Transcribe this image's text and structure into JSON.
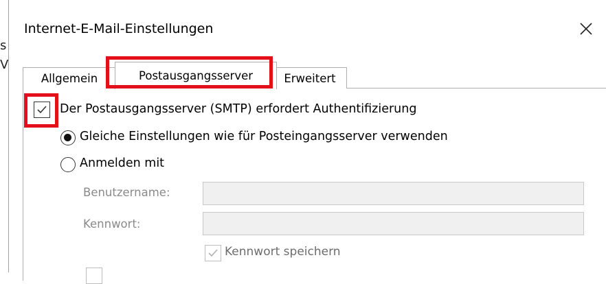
{
  "dialog": {
    "title": "Internet-E-Mail-Einstellungen"
  },
  "background_fragments": [
    "s",
    "V"
  ],
  "tabs": [
    {
      "label": "Allgemein",
      "selected": false
    },
    {
      "label": "Postausgangsserver",
      "selected": true
    },
    {
      "label": "Erweitert",
      "selected": false
    }
  ],
  "smtp": {
    "auth_label": "Der Postausgangsserver (SMTP) erfordert Authentifizierung",
    "auth_checked": true,
    "option_same": "Gleiche Einstellungen wie für Posteingangsserver verwenden",
    "option_same_selected": true,
    "option_login": "Anmelden mit",
    "option_login_selected": false,
    "username_label": "Benutzername:",
    "username_value": "",
    "password_label": "Kennwort:",
    "password_value": "",
    "save_password_label": "Kennwort speichern",
    "save_password_checked": true
  },
  "colors": {
    "highlight": "#e3101c",
    "disabled_text": "#8a8a8a",
    "disabled_field": "#f0f0f0"
  }
}
